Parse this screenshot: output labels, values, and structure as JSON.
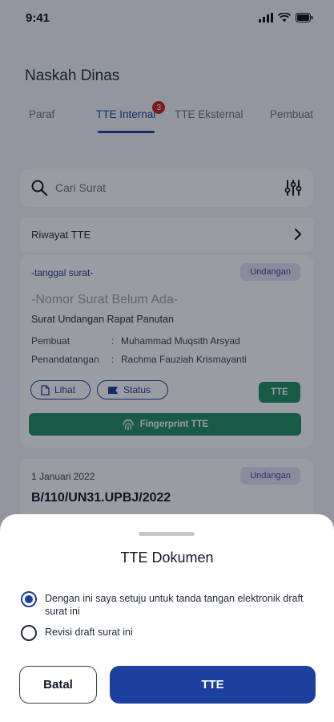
{
  "status_bar": {
    "time": "9:41"
  },
  "page_title": "Naskah Dinas",
  "tabs": [
    {
      "label": "Paraf"
    },
    {
      "label": "TTE Internal",
      "badge": "3",
      "active": true
    },
    {
      "label": "TTE Eksternal"
    },
    {
      "label": "Pembuat"
    }
  ],
  "search": {
    "placeholder": "Cari Surat"
  },
  "history": {
    "label": "Riwayat TTE"
  },
  "cards": [
    {
      "date": "-tanggal surat-",
      "category": "Undangan",
      "number": "-Nomor Surat Belum Ada-",
      "subject": "Surat Undangan Rapat Panutan",
      "meta": [
        {
          "key": "Pembuat",
          "value": "Muhammad Muqsith Arsyad"
        },
        {
          "key": "Penandatangan",
          "value": "Rachma Fauziah Krismayanti"
        }
      ],
      "buttons": {
        "view": "Lihat",
        "status": "Status",
        "tte": "TTE",
        "fingerprint": "Fingerprint TTE"
      }
    },
    {
      "date": "1 Januari 2022",
      "category": "Undangan",
      "number": "B/110/UN31.UPBJ/2022"
    }
  ],
  "sheet": {
    "title": "TTE Dokumen",
    "options": [
      {
        "label": "Dengan ini saya setuju untuk tanda tangan elektronik draft surat ini",
        "checked": true
      },
      {
        "label": "Revisi draft surat ini",
        "checked": false
      }
    ],
    "cancel_label": "Batal",
    "confirm_label": "TTE"
  },
  "colors": {
    "primary": "#1d3f9e",
    "success": "#1f8d5e",
    "badge": "#c81e1e"
  }
}
